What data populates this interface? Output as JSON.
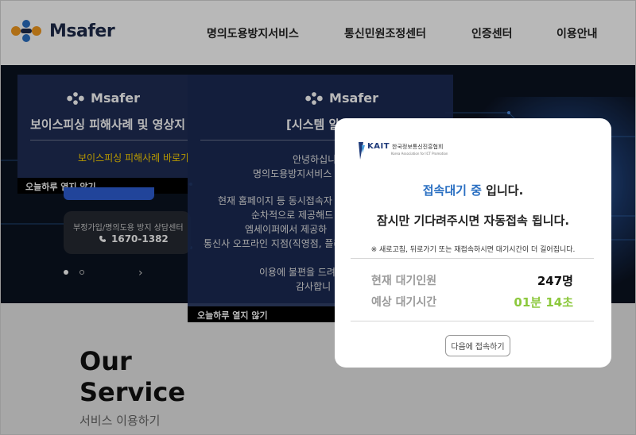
{
  "header": {
    "logo_text": "Msafer",
    "nav": [
      "명의도용방지서비스",
      "통신민원조정센터",
      "인증센터",
      "이용안내"
    ]
  },
  "colors": {
    "logo_orange": "#f39a1f",
    "logo_blue": "#2a6fc2",
    "popup_navy": "#1f2d55",
    "link_yellow": "#ffd400",
    "highlight_blue": "#2a6fc2",
    "value_green": "#8cc83c"
  },
  "popup1": {
    "logo_text": "Msafer",
    "title": "보이스피싱 피해사례 및 영상지",
    "link": "보이스피싱 피해사례 바로가",
    "footer": "오늘하루 열지 않기",
    "contact_label": "부정가입/명의도용 방지 상담센터",
    "contact_phone": "1670-1382",
    "contact_icon": "phone-icon"
  },
  "popup2": {
    "logo_text": "Msafer",
    "title": "[시스템 알",
    "lines": [
      "안녕하십니",
      "명의도용방지서비스 ",
      "현재 홈페이지 등 동시접속자 수",
      "순차적으로 제공해드",
      "엠세이퍼에서 제공하",
      "통신사 오프라인 지점(직영점, 플라",
      "이용에 불편을 드려",
      "감사합니"
    ],
    "footer": "오늘하루 열지 않기"
  },
  "modal": {
    "kait_word": "KAIT",
    "kait_org": "한국정보통신진흥협회",
    "kait_org_en": "Korea Association for ICT Promotion",
    "status_highlight": "접속대기 중",
    "status_rest": " 입니다.",
    "message": "잠시만 기다려주시면 자동접속 됩니다.",
    "note": "※ 새로고침, 뒤로가기 또는 재접속하시면 대기시간이 더 길어집니다.",
    "queue_label": "현재 대기인원",
    "queue_value": "247명",
    "wait_label": "예상 대기시간",
    "wait_value": "01분 14초",
    "retry_button": "다음에 접속하기"
  },
  "service": {
    "title_line1": "Our",
    "title_line2": "Service",
    "subtitle": "서비스 이용하기"
  }
}
